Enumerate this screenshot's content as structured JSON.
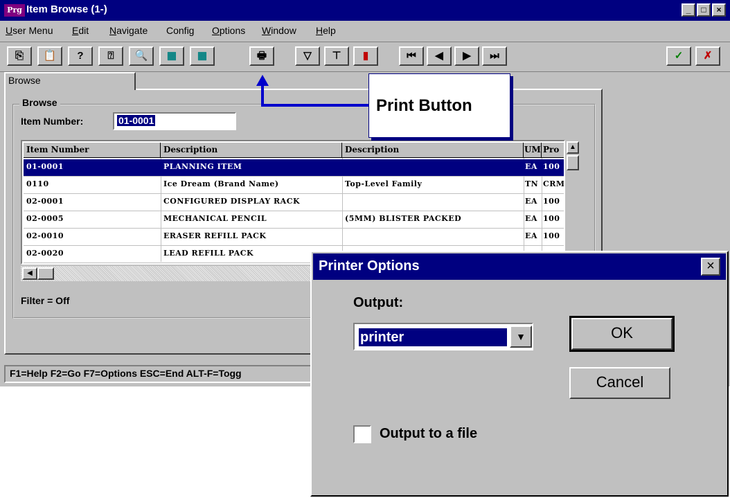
{
  "window": {
    "logo": "Prg",
    "title": "Item Browse (1-)",
    "controls": [
      "_",
      "□",
      "×"
    ]
  },
  "menu": [
    {
      "u": "U",
      "rest": "ser Menu"
    },
    {
      "u": "E",
      "rest": "dit"
    },
    {
      "u": "N",
      "rest": "avigate"
    },
    {
      "u": "",
      "rest": "Config"
    },
    {
      "u": "O",
      "rest": "ptions"
    },
    {
      "u": "W",
      "rest": "indow"
    },
    {
      "u": "H",
      "rest": "elp"
    }
  ],
  "toolbar": {
    "accept_glyph": "✓",
    "cancel_glyph": "✗"
  },
  "tab": {
    "label": "Browse"
  },
  "browse": {
    "group_label": "Browse",
    "item_number_label": "Item Number:",
    "item_number_value": "01-0001",
    "filter_status": "Filter = Off"
  },
  "table": {
    "columns": [
      "Item Number",
      "Description",
      "Description",
      "UM",
      "Pro"
    ],
    "rows": [
      [
        "01-0001",
        "PLANNING ITEM",
        "",
        "EA",
        "100"
      ],
      [
        "0110",
        "Ice Dream (Brand Name)",
        "Top-Level Family",
        "TN",
        "CRM"
      ],
      [
        "02-0001",
        "CONFIGURED DISPLAY RACK",
        "",
        "EA",
        "100"
      ],
      [
        "02-0005",
        "MECHANICAL PENCIL",
        "(5MM) BLISTER PACKED",
        "EA",
        "100"
      ],
      [
        "02-0010",
        "ERASER REFILL PACK",
        "",
        "EA",
        "100"
      ],
      [
        "02-0020",
        "LEAD REFILL PACK",
        "",
        "",
        ""
      ]
    ],
    "selected_row": 0
  },
  "statusbar": "F1=Help F2=Go F7=Options ESC=End ALT-F=Togg",
  "callout": {
    "text": "Print Button"
  },
  "dialog": {
    "title": "Printer Options",
    "close_glyph": "×",
    "output_label": "Output:",
    "output_value": "printer",
    "ok_label": "OK",
    "cancel_label": "Cancel",
    "file_checkbox_label": "Output to a file",
    "file_checked": false
  }
}
